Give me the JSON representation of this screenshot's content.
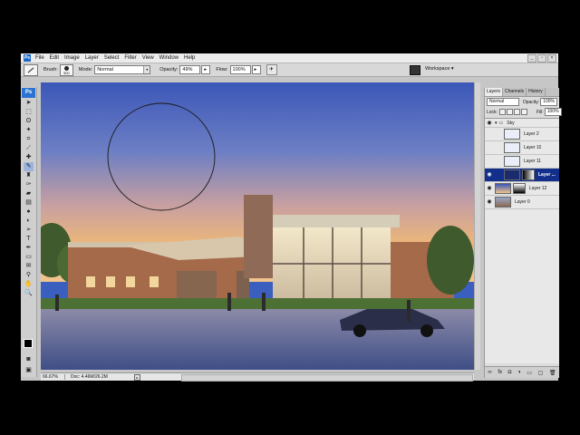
{
  "menu": {
    "items": [
      "File",
      "Edit",
      "Image",
      "Layer",
      "Select",
      "Filter",
      "View",
      "Window",
      "Help"
    ]
  },
  "options": {
    "brush_label": "Brush:",
    "brush_size": "500",
    "mode_label": "Mode:",
    "mode_value": "Normal",
    "opacity_label": "Opacity:",
    "opacity_value": "49%",
    "flow_label": "Flow:",
    "flow_value": "100%",
    "workspace_label": "Workspace ▾"
  },
  "toolbox": {
    "logo": "Ps"
  },
  "status": {
    "zoom": "66.67%",
    "doc_info": "Doc: 4.46M/26.2M"
  },
  "layers_panel": {
    "tabs": [
      "Layers",
      "Channels",
      "History"
    ],
    "blend_mode": "Normal",
    "opacity_label": "Opacity:",
    "opacity_value": "100%",
    "lock_label": "Lock:",
    "fill_label": "Fill:",
    "fill_value": "100%",
    "layers": [
      "Sky",
      "Layer 2",
      "Layer 10",
      "Layer 11",
      "Layer ...",
      "Layer 12",
      "Layer 0"
    ]
  },
  "colors": {
    "accent": "#122f8c",
    "sky_top": "#3a5fbf",
    "sky_bottom": "#e8b27a"
  }
}
